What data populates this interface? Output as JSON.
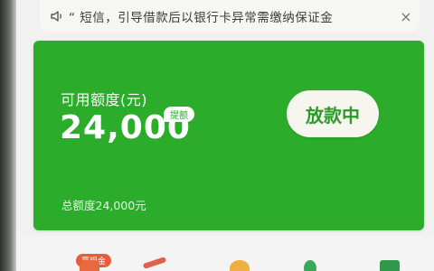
{
  "notice": {
    "icon": "speaker-icon",
    "text": "“ 短信，引导借款后以银行卡异常需缴纳保证金",
    "close_icon": "×"
  },
  "card": {
    "label_available": "可用额度(元)",
    "amount": "24,000",
    "tag_raise": "提额",
    "loan_button": "放款中",
    "label_total": "总额度24,000元",
    "color": "#2bac2b"
  },
  "bottom": {
    "badge_cash": "赢现金"
  }
}
